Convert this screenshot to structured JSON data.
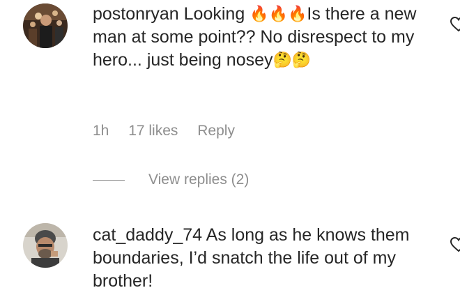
{
  "comments": [
    {
      "username": "postonryan",
      "text_parts": [
        "Looking ",
        "🔥",
        "🔥",
        "🔥",
        "Is there a new man at some point?? No disrespect to my hero... just being nosey",
        "🤔",
        "🤔"
      ],
      "time": "1h",
      "likes": "17 likes",
      "reply_label": "Reply",
      "view_replies": "View replies (2)",
      "avatar_icon": "profile-photo",
      "like_icon": "heart-outline-icon"
    },
    {
      "username": "cat_daddy_74",
      "text": "As long as he knows them boundaries, I’d snatch the life out of my brother!",
      "avatar_icon": "profile-photo",
      "like_icon": "heart-outline-icon"
    }
  ],
  "colors": {
    "text": "#262626",
    "meta": "#8e8e8e",
    "background": "#ffffff"
  }
}
